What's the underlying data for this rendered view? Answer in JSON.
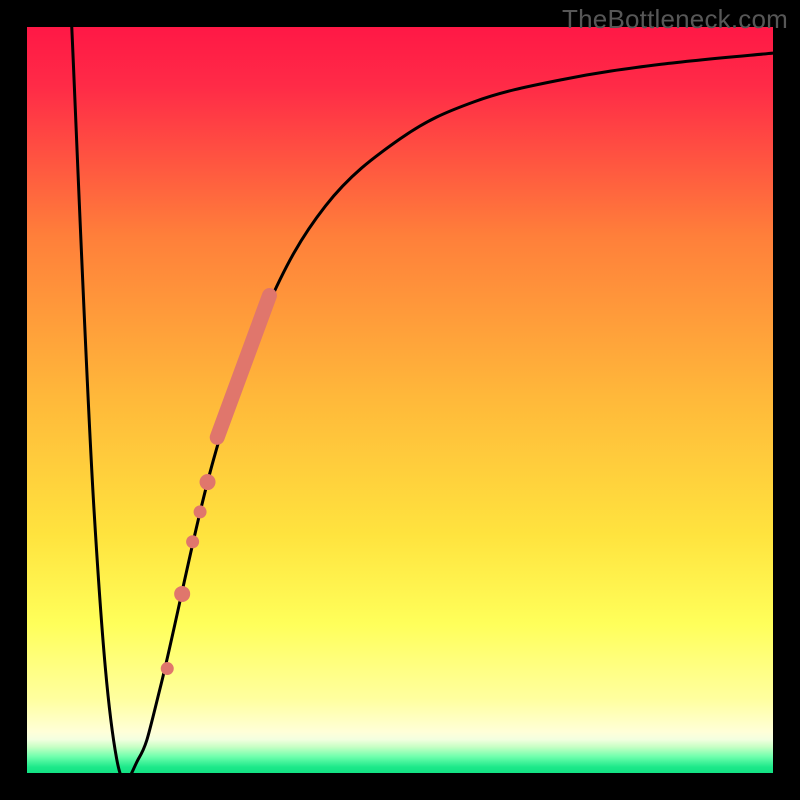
{
  "watermark": "TheBottleneck.com",
  "colors": {
    "top": "#ff1846",
    "mid_upper": "#ff7f3a",
    "mid": "#ffd33a",
    "mid_lower": "#ffff5a",
    "pale_yellow": "#ffffbe",
    "green": "#2bea8d",
    "curve": "#000000",
    "marker_fill": "#e0766c",
    "marker_stroke": "#b44d45"
  },
  "chart_data": {
    "type": "line",
    "title": "",
    "xlabel": "",
    "ylabel": "",
    "xlim": [
      0,
      100
    ],
    "ylim": [
      0,
      100
    ],
    "series": [
      {
        "name": "curve",
        "x": [
          6,
          9,
          12,
          15,
          18,
          25,
          32,
          40,
          50,
          60,
          72,
          85,
          100
        ],
        "y": [
          100,
          35,
          2,
          2,
          12,
          42,
          62,
          76,
          85,
          90,
          93,
          95,
          96.5
        ]
      }
    ],
    "markers": [
      {
        "name": "thick-segment",
        "x_range": [
          25.5,
          32.5
        ],
        "y_range": [
          45,
          64
        ],
        "width": 15
      },
      {
        "name": "dot",
        "x": 24.2,
        "y": 39,
        "r": 8
      },
      {
        "name": "dot",
        "x": 23.2,
        "y": 35,
        "r": 6.5
      },
      {
        "name": "dot",
        "x": 22.2,
        "y": 31,
        "r": 6.5
      },
      {
        "name": "dot",
        "x": 20.8,
        "y": 24,
        "r": 8
      },
      {
        "name": "dot",
        "x": 18.8,
        "y": 14,
        "r": 6.5
      }
    ]
  }
}
